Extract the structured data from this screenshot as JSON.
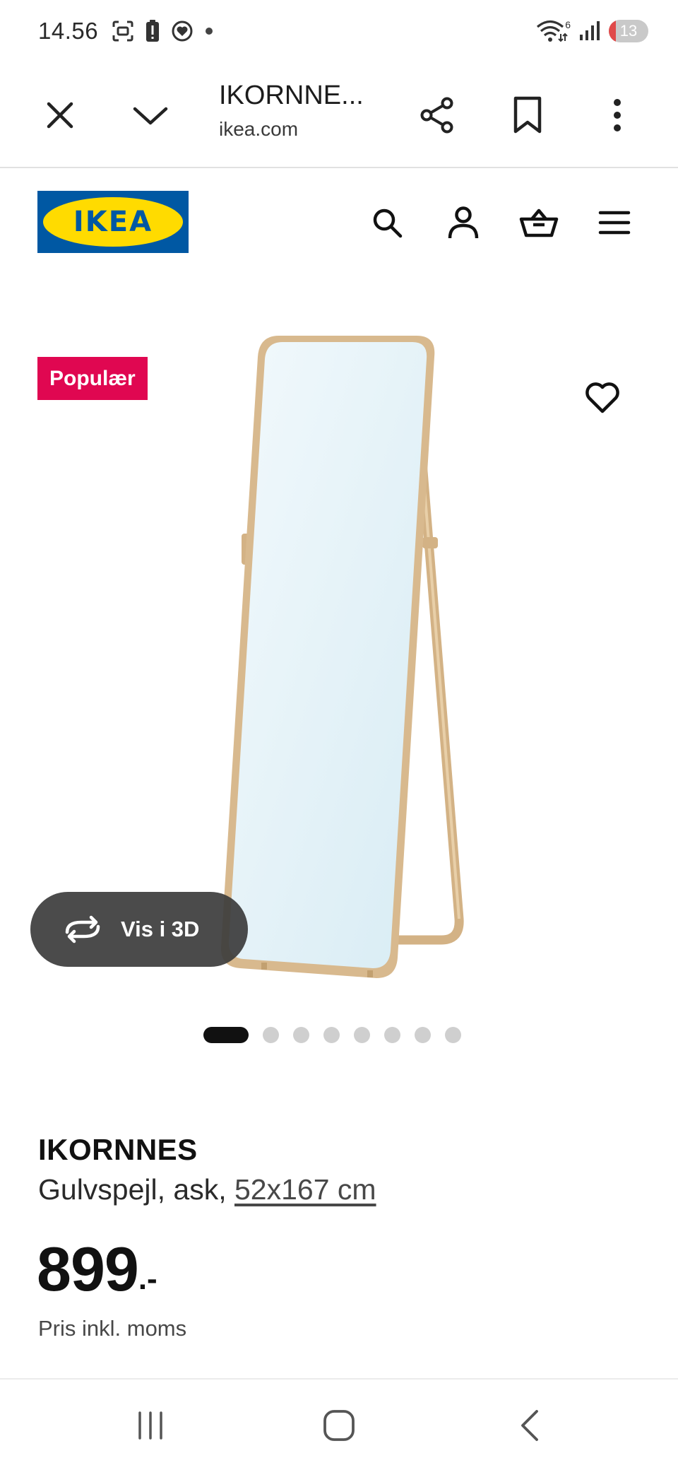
{
  "status_bar": {
    "time": "14.56",
    "wifi_badge": "6",
    "battery_level": "13"
  },
  "browser": {
    "page_title": "IKORNNE...",
    "domain": "ikea.com"
  },
  "site": {
    "logo_text": "IKEA"
  },
  "product": {
    "badge": "Populær",
    "view3d_label": "Vis i 3D",
    "gallery": {
      "count": 8,
      "active_index": 0
    },
    "name": "IKORNNES",
    "description": "Gulvspejl, ask, ",
    "dimensions": "52x167 cm",
    "price": "899",
    "price_suffix": ".-",
    "price_note": "Pris inkl. moms"
  },
  "colors": {
    "ikea_blue": "#0058a3",
    "ikea_yellow": "#ffdb00",
    "badge_red": "#e00751",
    "mirror_frame": "#d8b98e",
    "mirror_glass": "#dff0f6"
  }
}
